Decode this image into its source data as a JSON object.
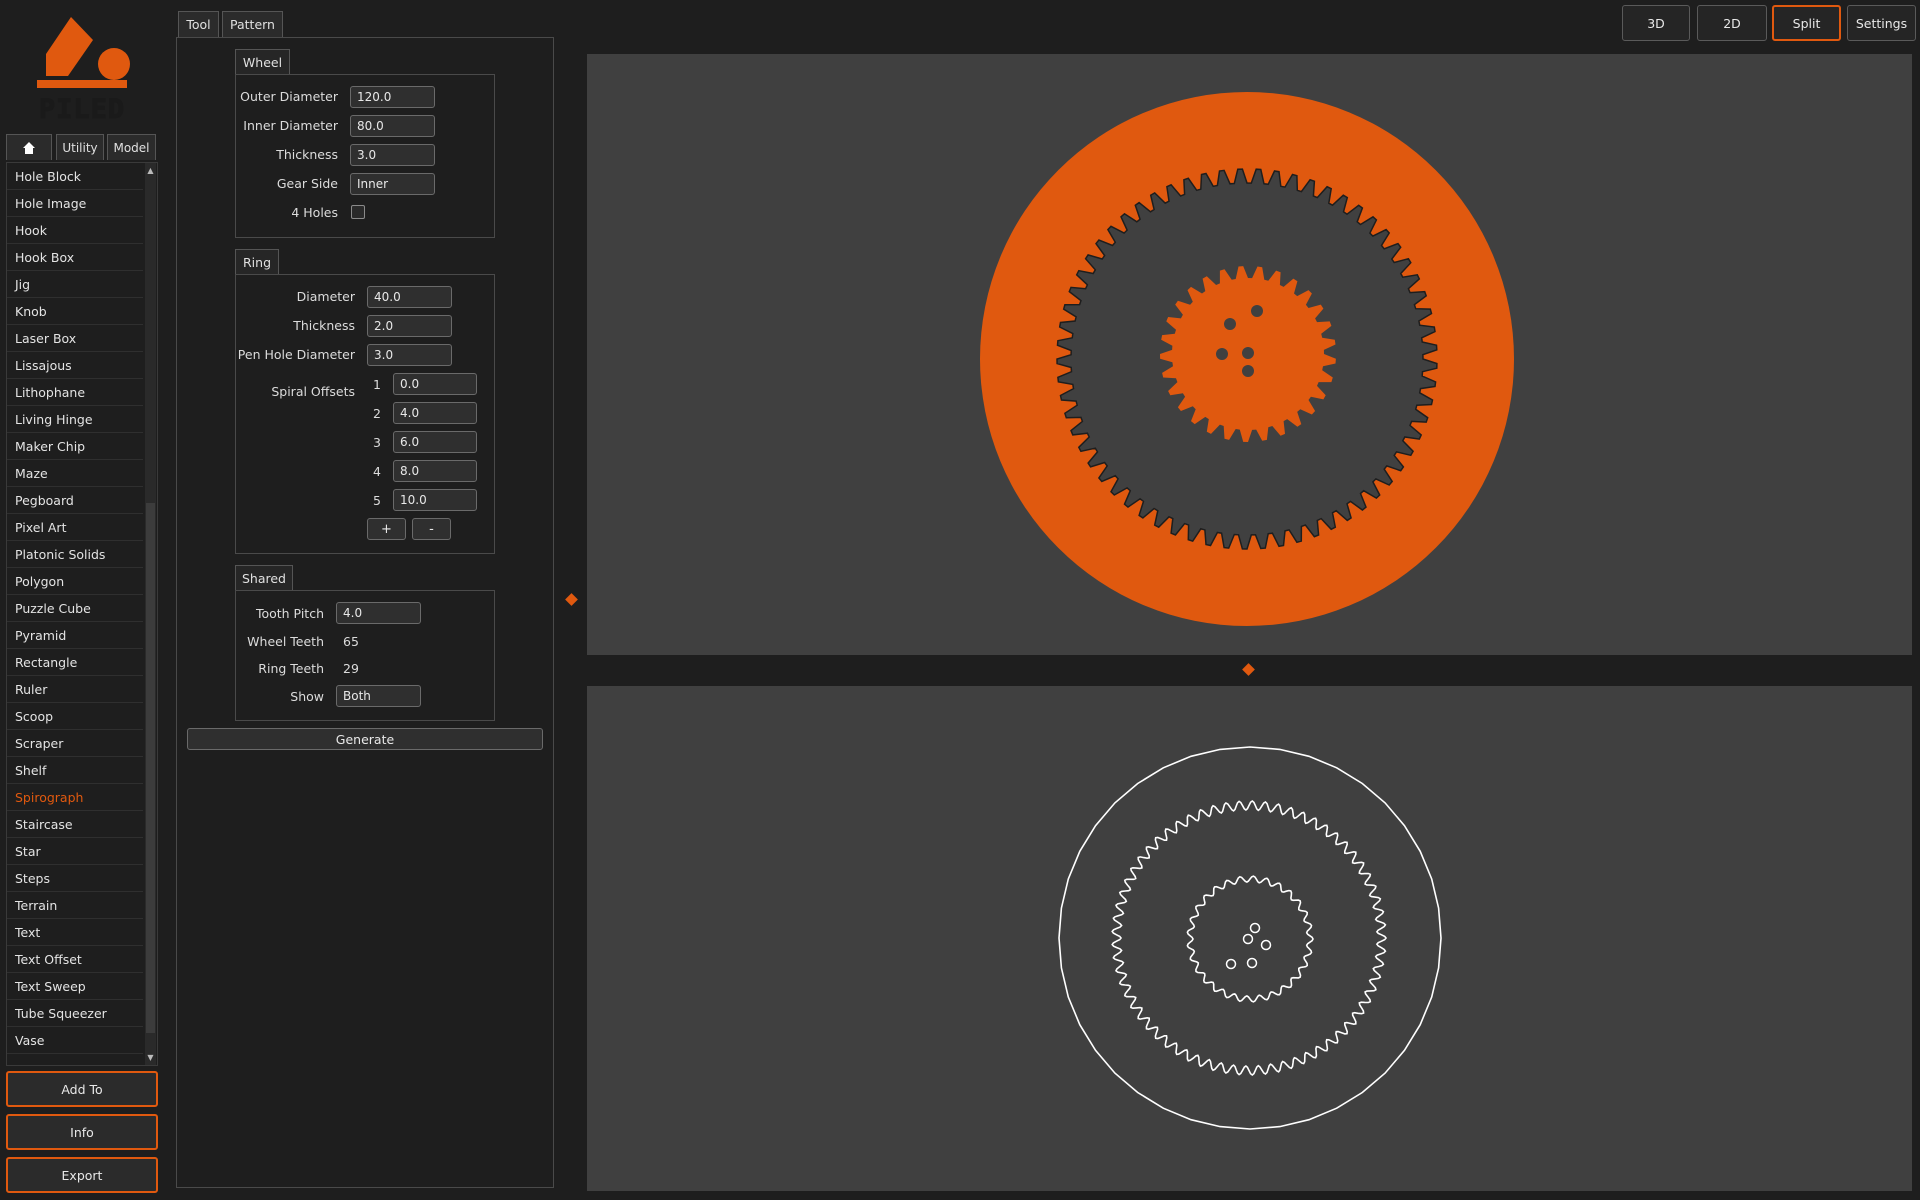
{
  "brand": {
    "name": "PILED",
    "accent": "#e0590f"
  },
  "sidebar": {
    "tabs": [
      {
        "icon": "home-icon"
      },
      {
        "label": "Utility"
      },
      {
        "label": "Model"
      }
    ],
    "items": [
      "Hole Block",
      "Hole Image",
      "Hook",
      "Hook Box",
      "Jig",
      "Knob",
      "Laser Box",
      "Lissajous",
      "Lithophane",
      "Living Hinge",
      "Maker Chip",
      "Maze",
      "Pegboard",
      "Pixel Art",
      "Platonic Solids",
      "Polygon",
      "Puzzle Cube",
      "Pyramid",
      "Rectangle",
      "Ruler",
      "Scoop",
      "Scraper",
      "Shelf",
      "Spirograph",
      "Staircase",
      "Star",
      "Steps",
      "Terrain",
      "Text",
      "Text Offset",
      "Text Sweep",
      "Tube Squeezer",
      "Vase"
    ],
    "selected_item": "Spirograph",
    "buttons": {
      "add_to": "Add To",
      "info": "Info",
      "export": "Export"
    }
  },
  "panel": {
    "tabs": {
      "tool": "Tool",
      "pattern": "Pattern"
    },
    "wheel": {
      "title": "Wheel",
      "outer_diameter_label": "Outer Diameter",
      "outer_diameter": "120.0",
      "inner_diameter_label": "Inner Diameter",
      "inner_diameter": "80.0",
      "thickness_label": "Thickness",
      "thickness": "3.0",
      "gear_side_label": "Gear Side",
      "gear_side": "Inner",
      "four_holes_label": "4 Holes",
      "four_holes_checked": false
    },
    "ring": {
      "title": "Ring",
      "diameter_label": "Diameter",
      "diameter": "40.0",
      "thickness_label": "Thickness",
      "thickness": "2.0",
      "pen_hole_label": "Pen Hole Diameter",
      "pen_hole": "3.0",
      "spiral_offsets_label": "Spiral Offsets",
      "offsets": [
        {
          "index": "1",
          "value": "0.0"
        },
        {
          "index": "2",
          "value": "4.0"
        },
        {
          "index": "3",
          "value": "6.0"
        },
        {
          "index": "4",
          "value": "8.0"
        },
        {
          "index": "5",
          "value": "10.0"
        }
      ],
      "add_label": "+",
      "remove_label": "-"
    },
    "shared": {
      "title": "Shared",
      "tooth_pitch_label": "Tooth Pitch",
      "tooth_pitch": "4.0",
      "wheel_teeth_label": "Wheel Teeth",
      "wheel_teeth": "65",
      "ring_teeth_label": "Ring Teeth",
      "ring_teeth": "29",
      "show_label": "Show",
      "show": "Both"
    },
    "generate_label": "Generate"
  },
  "view_modes": {
    "three_d": "3D",
    "two_d": "2D",
    "split": "Split",
    "settings": "Settings",
    "active": "Split"
  },
  "colors": {
    "background": "#1e1e1e",
    "viewport": "#404040",
    "accent": "#e0590f",
    "outline": "#ffffff"
  }
}
